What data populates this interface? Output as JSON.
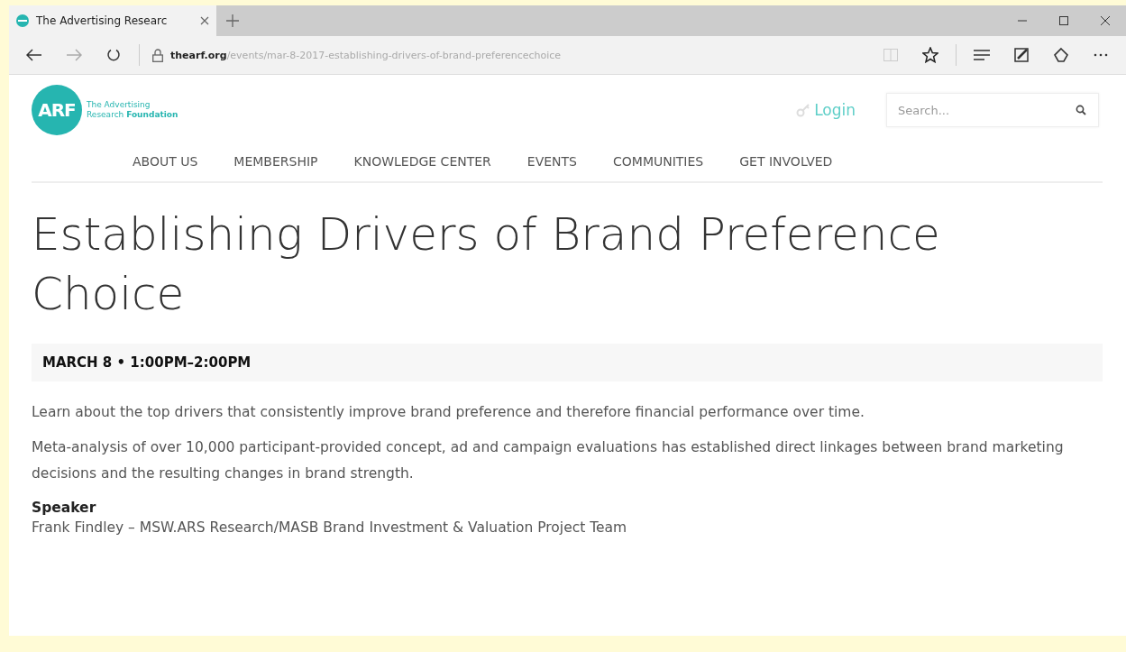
{
  "browser": {
    "tab": {
      "title": "The Advertising Researc",
      "selected": true
    },
    "address": {
      "domain": "thearf.org",
      "path": "/events/mar-8-2017-establishing-drivers-of-brand-preferencechoice"
    }
  },
  "site": {
    "logo": {
      "mark": "ARF",
      "line1": "The Advertising",
      "line2a": "Research ",
      "line2b": "Foundation"
    },
    "login": "Login",
    "search": {
      "placeholder": "Search..."
    },
    "nav": [
      "ABOUT US",
      "MEMBERSHIP",
      "KNOWLEDGE CENTER",
      "EVENTS",
      "COMMUNITIES",
      "GET INVOLVED"
    ]
  },
  "event": {
    "title": "Establishing Drivers of Brand Preference Choice",
    "when": "MARCH 8 • 1:00PM–2:00PM",
    "paragraphs": [
      "Learn about the top drivers that consistently improve brand preference and therefore financial performance over time.",
      "Meta-analysis of over 10,000 participant-provided concept, ad and campaign evaluations has established direct linkages between brand marketing decisions and the resulting changes in brand strength."
    ],
    "speaker_heading": "Speaker",
    "speaker": "Frank Findley – MSW.ARS Research/MASB Brand Investment & Valuation Project Team"
  }
}
